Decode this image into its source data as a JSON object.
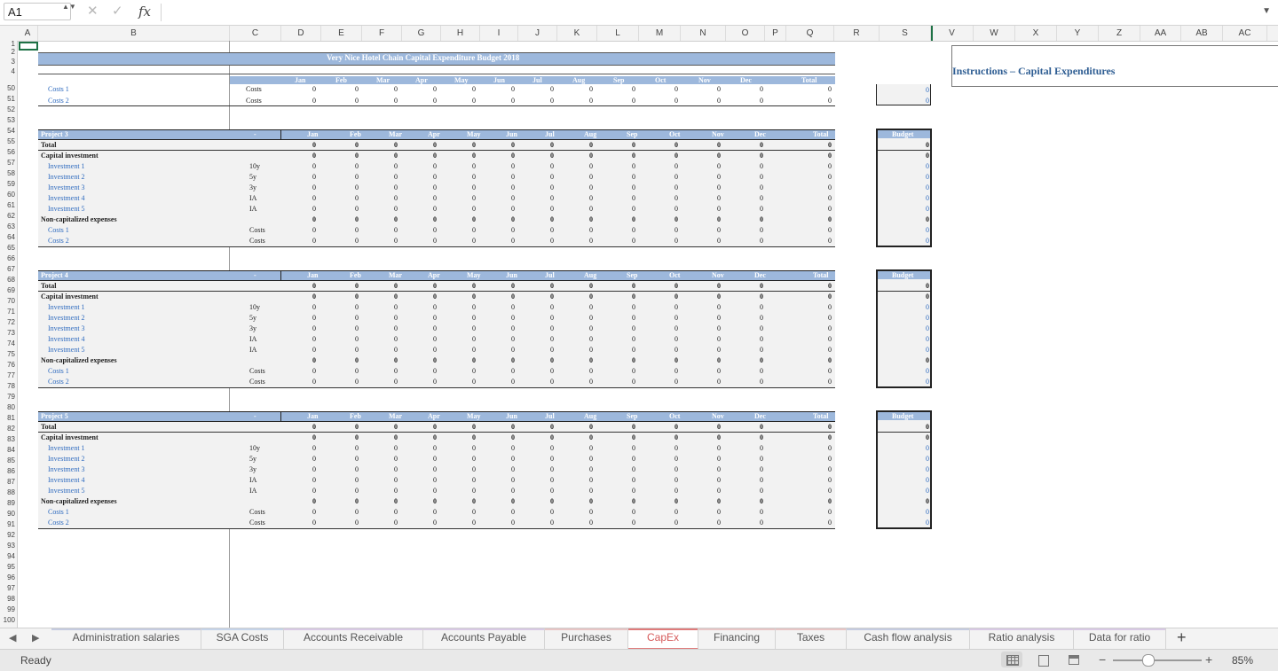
{
  "formula_bar": {
    "name_box": "A1",
    "formula": "",
    "cancel_icon": "✕",
    "enter_icon": "✓",
    "fx_label": "fx",
    "expand_icon": "▼",
    "stepper_icon": "▲▼"
  },
  "columns": [
    "A",
    "B",
    "C",
    "D",
    "E",
    "F",
    "G",
    "H",
    "I",
    "J",
    "K",
    "L",
    "M",
    "N",
    "O",
    "P",
    "Q",
    "R",
    "S",
    "V",
    "W",
    "X",
    "Y",
    "Z",
    "AA",
    "AB",
    "AC"
  ],
  "rows": [
    "1",
    "2",
    "3",
    "4",
    "50",
    "51",
    "52",
    "53",
    "54",
    "55",
    "56",
    "57",
    "58",
    "59",
    "60",
    "61",
    "62",
    "63",
    "64",
    "65",
    "66",
    "67",
    "68",
    "69",
    "70",
    "71",
    "72",
    "73",
    "74",
    "75",
    "76",
    "77",
    "78",
    "79",
    "80",
    "81",
    "82",
    "83",
    "84",
    "85",
    "86",
    "87",
    "88",
    "89",
    "90",
    "91",
    "92",
    "93",
    "94",
    "95",
    "96",
    "97",
    "98",
    "99",
    "100"
  ],
  "sheet": {
    "title": "Very Nice Hotel Chain Capital Expenditure Budget 2018",
    "instructions_title": "Instructions – Capital Expenditures",
    "months": [
      "Jan",
      "Feb",
      "Mar",
      "Apr",
      "May",
      "Jun",
      "Jul",
      "Aug",
      "Sep",
      "Oct",
      "Nov",
      "Dec"
    ],
    "total_label": "Total",
    "budget_label": "Budget",
    "dash": "-",
    "zero": "0",
    "frozen_rows": [
      {
        "label": "Costs 1",
        "type": "Costs"
      },
      {
        "label": "Costs 2",
        "type": "Costs"
      }
    ],
    "projects": [
      {
        "name": "Project 3"
      },
      {
        "name": "Project 4"
      },
      {
        "name": "Project 5"
      }
    ],
    "block_rows": [
      {
        "label": "Total",
        "type": "",
        "style": "bold"
      },
      {
        "label": "Capital investment",
        "type": "",
        "style": "bold"
      },
      {
        "label": "Investment 1",
        "type": "10y",
        "style": "sub"
      },
      {
        "label": "Investment 2",
        "type": "5y",
        "style": "sub"
      },
      {
        "label": "Investment 3",
        "type": "3y",
        "style": "sub"
      },
      {
        "label": "Investment 4",
        "type": "IA",
        "style": "sub"
      },
      {
        "label": "Investment 5",
        "type": "IA",
        "style": "sub"
      },
      {
        "label": "Non-capitalized expenses",
        "type": "",
        "style": "bold"
      },
      {
        "label": "Costs 1",
        "type": "Costs",
        "style": "sub"
      },
      {
        "label": "Costs 2",
        "type": "Costs",
        "style": "sub"
      }
    ]
  },
  "tabs": [
    {
      "label": "Administration salaries",
      "accent": "#c5cbe0"
    },
    {
      "label": "SGA Costs",
      "accent": "#c5d3e8"
    },
    {
      "label": "Accounts Receivable",
      "accent": "#d8c9e4"
    },
    {
      "label": "Accounts Payable",
      "accent": "#d8c9e4"
    },
    {
      "label": "Purchases",
      "accent": "#e7c5c5"
    },
    {
      "label": "CapEx",
      "accent": "#e07b7b",
      "active": true
    },
    {
      "label": "Financing",
      "accent": "#e7c5c5"
    },
    {
      "label": "Taxes",
      "accent": "#e7c5c5"
    },
    {
      "label": "Cash flow analysis",
      "accent": "#c5cbe0"
    },
    {
      "label": "Ratio analysis",
      "accent": "#d8c9e4"
    },
    {
      "label": "Data for ratio",
      "accent": "#d8c9e4"
    }
  ],
  "add_sheet_icon": "+",
  "nav_prev_icon": "◀",
  "nav_next_icon": "▶",
  "status": {
    "text": "Ready",
    "zoom": "85%",
    "zoom_minus": "−",
    "zoom_plus": "+"
  },
  "colors": {
    "header_band": "#9db8dc",
    "link_blue": "#2f6bbf",
    "active_tab": "#d65a5a",
    "instructions_text": "#2f5e93"
  }
}
